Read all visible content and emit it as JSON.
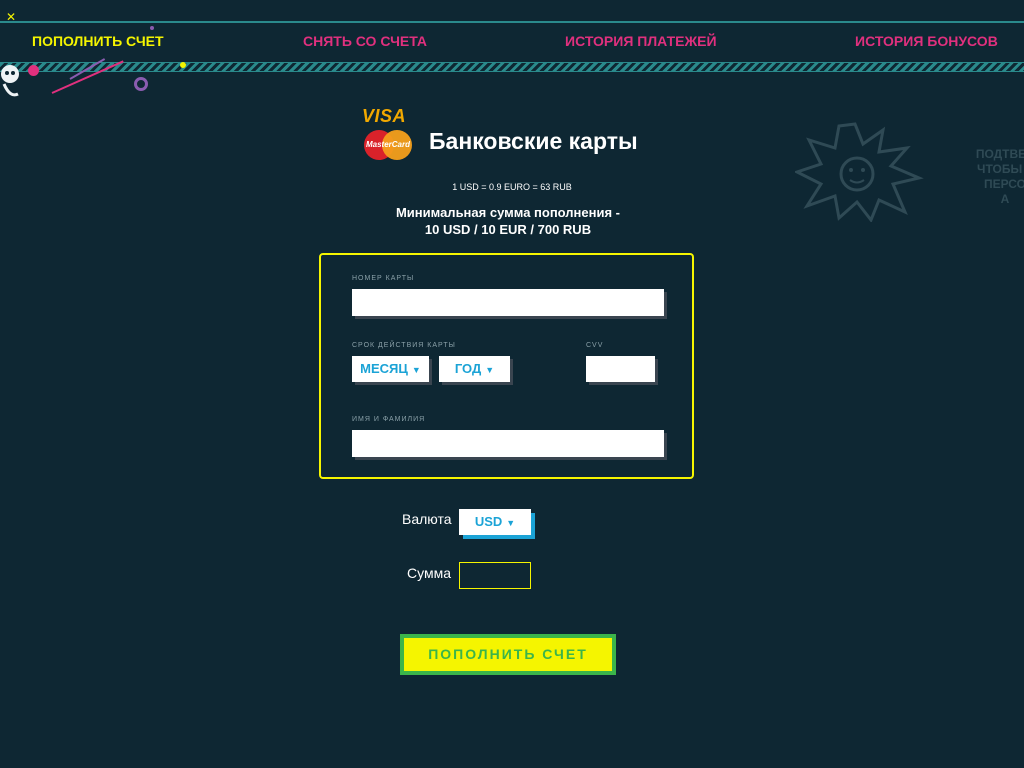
{
  "nav": {
    "items": [
      {
        "label": "ПОПОЛНИТЬ СЧЕТ",
        "active": true
      },
      {
        "label": "СНЯТЬ СО СЧЕТА",
        "active": false
      },
      {
        "label": "ИСТОРИЯ ПЛАТЕЖЕЙ",
        "active": false
      },
      {
        "label": "ИСТОРИЯ БОНУСОВ",
        "active": false
      }
    ]
  },
  "payment": {
    "visa_logo": "VISA",
    "mastercard_logo": "MasterCard",
    "title": "Банковские карты",
    "rate": "1 USD = 0.9 EURO = 63 RUB",
    "min_line1": "Минимальная сумма пополнения -",
    "min_line2": "10 USD / 10 EUR / 700 RUB"
  },
  "card_form": {
    "card_number_label": "НОМЕР КАРТЫ",
    "card_number_value": "",
    "expiry_label": "СРОК ДЕЙСТВИЯ КАРТЫ",
    "month_select": "МЕСЯЦ",
    "year_select": "ГОД",
    "cvv_label": "CVV",
    "cvv_value": "",
    "name_label": "ИМЯ И ФАМИЛИЯ",
    "name_value": ""
  },
  "currency": {
    "label": "Валюта",
    "selected": "USD"
  },
  "amount": {
    "label": "Сумма",
    "value": ""
  },
  "submit_label": "ПОПОЛНИТЬ СЧЕТ",
  "promo_text": [
    "ПОДТВЕР",
    "ЧТОБЫ У",
    "ПЕРСО",
    "А"
  ],
  "colors": {
    "background": "#0e2733",
    "accent_yellow": "#f5f500",
    "accent_pink": "#e0307e",
    "accent_blue": "#1ba3d6",
    "accent_green": "#3bb54a"
  }
}
